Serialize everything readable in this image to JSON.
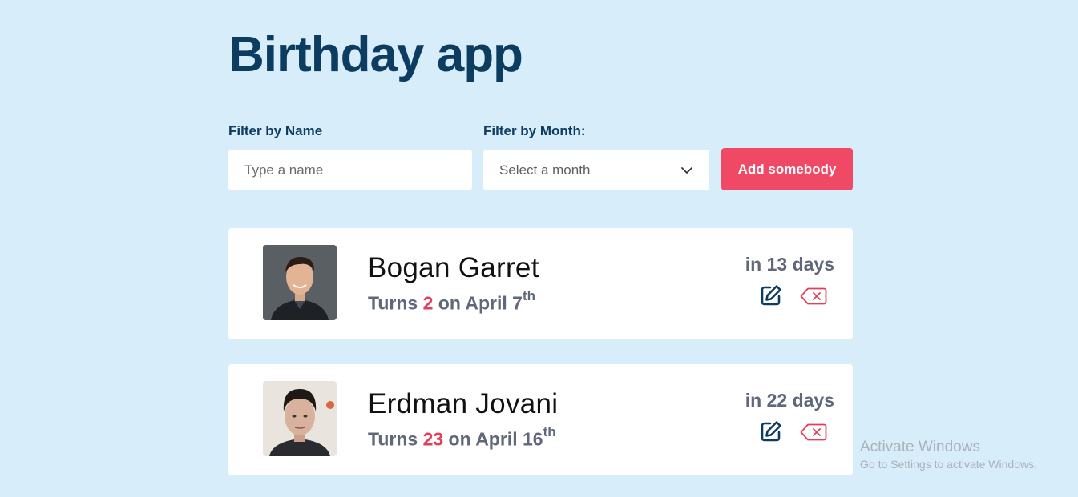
{
  "app": {
    "title": "Birthday app"
  },
  "filters": {
    "name_label": "Filter by Name",
    "name_placeholder": "Type a name",
    "month_label": "Filter by Month:",
    "month_selected": "Select a month"
  },
  "actions": {
    "add_label": "Add somebody"
  },
  "people": [
    {
      "name": "Bogan Garret",
      "turns_prefix": "Turns ",
      "age": "2",
      "date_text": " on April 7",
      "ordinal": "th",
      "countdown": "in 13 days"
    },
    {
      "name": "Erdman Jovani",
      "turns_prefix": "Turns ",
      "age": "23",
      "date_text": " on April 16",
      "ordinal": "th",
      "countdown": "in 22 days"
    }
  ],
  "icons": {
    "edit": "edit-icon",
    "delete": "delete-icon",
    "chevron": "chevron-down-icon"
  },
  "colors": {
    "primary": "#0d3c61",
    "accent": "#ef4966",
    "background": "#d8edfa",
    "age": "#e0405b"
  },
  "watermark": {
    "title": "Activate Windows",
    "subtitle": "Go to Settings to activate Windows."
  }
}
